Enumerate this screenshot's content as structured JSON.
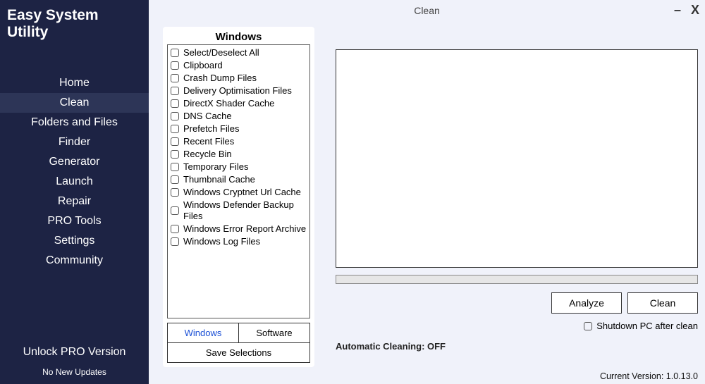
{
  "app": {
    "title": "Easy System Utility"
  },
  "sidebar": {
    "items": [
      {
        "label": "Home"
      },
      {
        "label": "Clean",
        "active": true
      },
      {
        "label": "Folders and Files"
      },
      {
        "label": "Finder"
      },
      {
        "label": "Generator"
      },
      {
        "label": "Launch"
      },
      {
        "label": "Repair"
      },
      {
        "label": "PRO Tools"
      },
      {
        "label": "Settings"
      },
      {
        "label": "Community"
      }
    ],
    "unlock": "Unlock PRO Version",
    "updates": "No New Updates"
  },
  "titlebar": {
    "title": "Clean",
    "minimize": "–",
    "close": "X"
  },
  "cleanPanel": {
    "heading": "Windows",
    "items": [
      "Select/Deselect All",
      "Clipboard",
      "Crash Dump Files",
      "Delivery Optimisation Files",
      "DirectX Shader Cache",
      "DNS Cache",
      "Prefetch Files",
      "Recent Files",
      "Recycle Bin",
      "Temporary Files",
      "Thumbnail Cache",
      "Windows Cryptnet Url Cache",
      "Windows Defender Backup Files",
      "Windows Error Report Archive",
      "Windows Log Files"
    ],
    "tabs": {
      "windows": "Windows",
      "software": "Software"
    },
    "save": "Save Selections"
  },
  "actions": {
    "analyze": "Analyze",
    "clean": "Clean",
    "shutdown": "Shutdown PC after clean",
    "auto": "Automatic Cleaning: OFF"
  },
  "footer": {
    "version": "Current Version: 1.0.13.0"
  }
}
